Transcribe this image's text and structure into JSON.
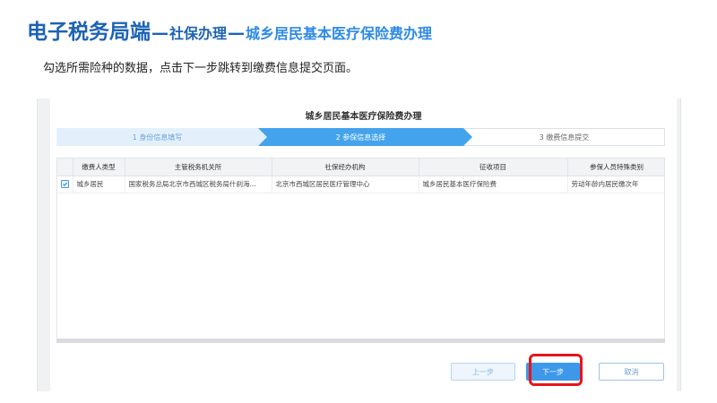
{
  "slide": {
    "title_main": "电子税务局端",
    "sep1": "—",
    "title_sub1": "社保办理",
    "sep2": "—",
    "title_sub2": "城乡居民基本医疗保险费办理",
    "instruction": "勾选所需险种的数据，点击下一步跳转到缴费信息提交页面。"
  },
  "form": {
    "title": "城乡居民基本医疗保险费办理",
    "steps": [
      {
        "label": "1 身份信息填写",
        "state": "completed"
      },
      {
        "label": "2 参保信息选择",
        "state": "active"
      },
      {
        "label": "3 缴费信息提交",
        "state": "pending"
      }
    ],
    "table": {
      "columns": [
        "缴费人类型",
        "主管税务机关所",
        "社保经办机构",
        "征收项目",
        "参保人员特殊类别"
      ],
      "rows": [
        {
          "checked": true,
          "cells": [
            "城乡居民",
            "国家税务总局北京市西城区税务局什刹海...",
            "北京市西城区居民医疗管理中心",
            "城乡居民基本医疗保险费",
            "劳动年龄内居民缴次年"
          ]
        }
      ]
    },
    "buttons": {
      "prev": "上一步",
      "next": "下一步",
      "cancel": "取消"
    }
  },
  "colors": {
    "title_blue": "#1d63b4",
    "accent_blue": "#43a3ec",
    "highlight_red": "#e8141b"
  }
}
